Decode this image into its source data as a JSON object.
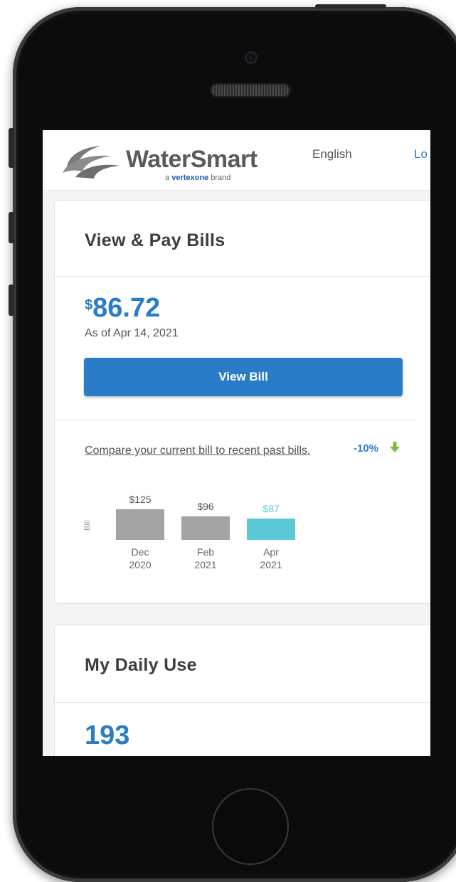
{
  "header": {
    "brand_name": "WaterSmart",
    "brand_tagline_pre": "a",
    "brand_tagline_brand": "vertexone",
    "brand_tagline_post": "brand",
    "language_label": "English",
    "login_label": "Lo"
  },
  "bills_card": {
    "title": "View & Pay Bills",
    "currency_symbol": "$",
    "amount": "86.72",
    "as_of": "As of Apr 14, 2021",
    "view_bill_label": "View Bill",
    "compare_text": "Compare your current bill to recent past bills.",
    "change_percent": "-10%",
    "change_direction_icon": "arrow-down-icon",
    "colors": {
      "accent": "#2a7bc8",
      "past_bar": "#a3a3a3",
      "current_bar": "#5bc8d8",
      "down_arrow": "#7ab648"
    }
  },
  "chart_data": {
    "type": "bar",
    "ylabel": "Bill",
    "categories": [
      "Dec 2020",
      "Feb 2021",
      "Apr 2021"
    ],
    "category_lines": [
      [
        "Dec",
        "2020"
      ],
      [
        "Feb",
        "2021"
      ],
      [
        "Apr",
        "2021"
      ]
    ],
    "values": [
      125,
      96,
      87
    ],
    "value_labels": [
      "$125",
      "$96",
      "$87"
    ],
    "highlight_index": 2
  },
  "daily_card": {
    "title": "My Daily Use",
    "value": "193"
  }
}
